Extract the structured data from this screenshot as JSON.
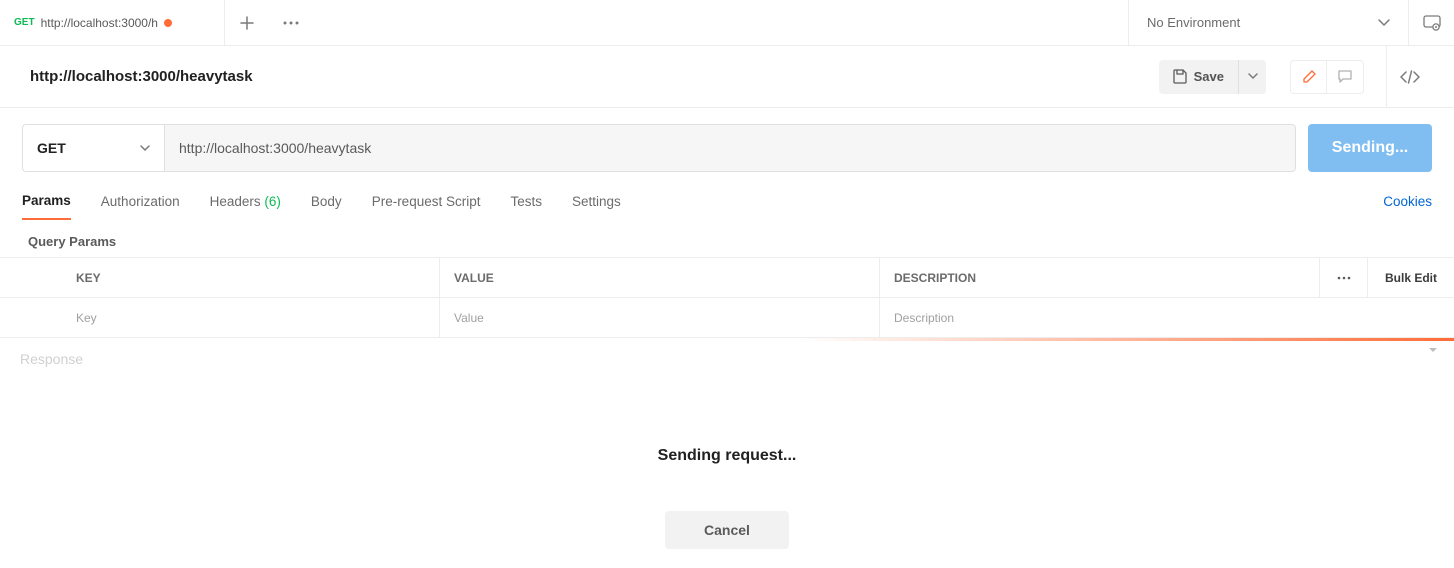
{
  "topbar": {
    "tab": {
      "method": "GET",
      "title": "http://localhost:3000/h"
    },
    "env_label": "No Environment"
  },
  "titlebar": {
    "request_name": "http://localhost:3000/heavytask",
    "save_label": "Save"
  },
  "request": {
    "method": "GET",
    "url": "http://localhost:3000/heavytask",
    "send_label": "Sending..."
  },
  "subtabs": {
    "params": "Params",
    "authorization": "Authorization",
    "headers": "Headers",
    "headers_count": "(6)",
    "body": "Body",
    "prerequest": "Pre-request Script",
    "tests": "Tests",
    "settings": "Settings",
    "cookies": "Cookies"
  },
  "query_params": {
    "section_title": "Query Params",
    "header": {
      "key": "KEY",
      "value": "VALUE",
      "description": "DESCRIPTION",
      "bulk": "Bulk Edit"
    },
    "placeholder": {
      "key": "Key",
      "value": "Value",
      "description": "Description"
    }
  },
  "response": {
    "title": "Response",
    "sending_msg": "Sending request...",
    "cancel_label": "Cancel"
  }
}
